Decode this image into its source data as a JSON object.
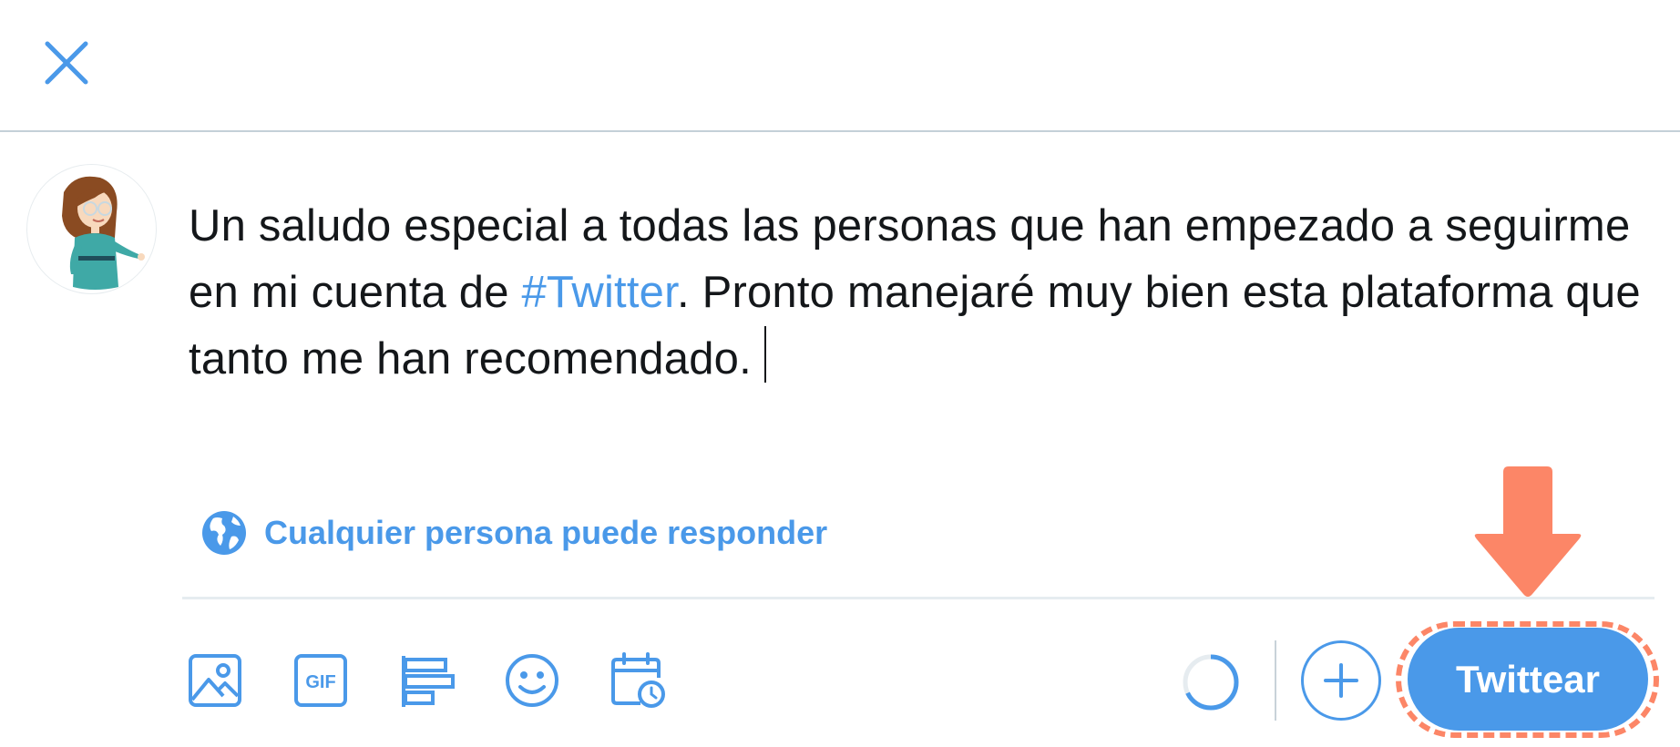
{
  "window": {
    "close_icon": "close-icon"
  },
  "composer": {
    "avatar_icon": "avatar-illustration",
    "text_before_hashtag": "Un saludo especial a todas las personas que han empezado a seguirme en mi cuenta de ",
    "hashtag": "#Twitter",
    "text_after_hashtag": ". Pronto manejaré muy bien esta plataforma que tanto me han recomendado.",
    "reply_settings_icon": "globe-icon",
    "reply_settings_label": "Cualquier persona puede responder"
  },
  "toolbar": {
    "tools": [
      {
        "name": "media",
        "icon": "image-icon"
      },
      {
        "name": "gif",
        "icon": "gif-icon"
      },
      {
        "name": "poll",
        "icon": "poll-icon"
      },
      {
        "name": "emoji",
        "icon": "emoji-icon"
      },
      {
        "name": "schedule",
        "icon": "schedule-icon"
      }
    ],
    "character_progress": 0.68,
    "add_thread_icon": "plus-icon",
    "tweet_button_label": "Twittear"
  },
  "annotation": {
    "arrow_icon": "arrow-down-icon",
    "highlight": "dashed-outline"
  },
  "colors": {
    "accent": "#4a99e9",
    "text": "#14171a",
    "annotation": "#fc8667",
    "divider": "#e6ecf0"
  }
}
